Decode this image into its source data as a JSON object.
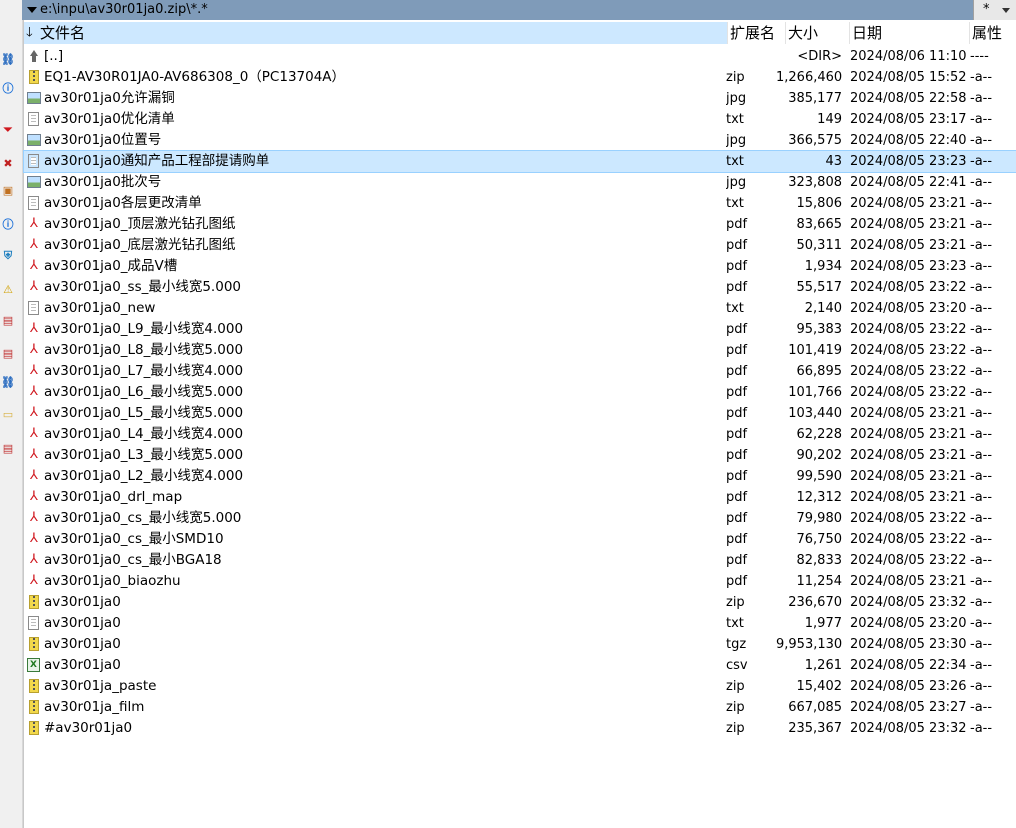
{
  "pathbar": {
    "path": "e:\\inpu\\av30r01ja0.zip\\*.*",
    "filter": "*"
  },
  "left_icons": [
    "network-icon",
    "info-icon",
    "pdf-icon",
    "delete-icon",
    "image-icon",
    "info-icon",
    "shield-icon",
    "warning-icon",
    "document-icon",
    "document-icon",
    "network-icon",
    "folder-icon",
    "document-icon"
  ],
  "columns": {
    "name": "文件名",
    "ext": "扩展名",
    "size": "大小",
    "date": "日期",
    "attr": "属性"
  },
  "files": [
    {
      "name": "[..]",
      "ext": "",
      "size": "<DIR>",
      "date": "2024/08/06 11:10",
      "attr": "----",
      "icon": "up"
    },
    {
      "name": "EQ1-AV30R01JA0-AV686308_0（PC13704A）",
      "ext": "zip",
      "size": "1,266,460",
      "date": "2024/08/05 15:52",
      "attr": "-a--",
      "icon": "zip"
    },
    {
      "name": "av30r01ja0允许漏铜",
      "ext": "jpg",
      "size": "385,177",
      "date": "2024/08/05 22:58",
      "attr": "-a--",
      "icon": "img"
    },
    {
      "name": "av30r01ja0优化清单",
      "ext": "txt",
      "size": "149",
      "date": "2024/08/05 23:17",
      "attr": "-a--",
      "icon": "txt"
    },
    {
      "name": "av30r01ja0位置号",
      "ext": "jpg",
      "size": "366,575",
      "date": "2024/08/05 22:40",
      "attr": "-a--",
      "icon": "img"
    },
    {
      "name": "av30r01ja0通知产品工程部提请购单",
      "ext": "txt",
      "size": "43",
      "date": "2024/08/05 23:23",
      "attr": "-a--",
      "icon": "txt",
      "selected": true
    },
    {
      "name": "av30r01ja0批次号",
      "ext": "jpg",
      "size": "323,808",
      "date": "2024/08/05 22:41",
      "attr": "-a--",
      "icon": "img"
    },
    {
      "name": "av30r01ja0各层更改清单",
      "ext": "txt",
      "size": "15,806",
      "date": "2024/08/05 23:21",
      "attr": "-a--",
      "icon": "txt"
    },
    {
      "name": "av30r01ja0_顶层激光钻孔图纸",
      "ext": "pdf",
      "size": "83,665",
      "date": "2024/08/05 23:21",
      "attr": "-a--",
      "icon": "pdf"
    },
    {
      "name": "av30r01ja0_底层激光钻孔图纸",
      "ext": "pdf",
      "size": "50,311",
      "date": "2024/08/05 23:21",
      "attr": "-a--",
      "icon": "pdf"
    },
    {
      "name": "av30r01ja0_成品V槽",
      "ext": "pdf",
      "size": "1,934",
      "date": "2024/08/05 23:23",
      "attr": "-a--",
      "icon": "pdf"
    },
    {
      "name": "av30r01ja0_ss_最小线宽5.000",
      "ext": "pdf",
      "size": "55,517",
      "date": "2024/08/05 23:22",
      "attr": "-a--",
      "icon": "pdf"
    },
    {
      "name": "av30r01ja0_new",
      "ext": "txt",
      "size": "2,140",
      "date": "2024/08/05 23:20",
      "attr": "-a--",
      "icon": "txt"
    },
    {
      "name": "av30r01ja0_L9_最小线宽4.000",
      "ext": "pdf",
      "size": "95,383",
      "date": "2024/08/05 23:22",
      "attr": "-a--",
      "icon": "pdf"
    },
    {
      "name": "av30r01ja0_L8_最小线宽5.000",
      "ext": "pdf",
      "size": "101,419",
      "date": "2024/08/05 23:22",
      "attr": "-a--",
      "icon": "pdf"
    },
    {
      "name": "av30r01ja0_L7_最小线宽4.000",
      "ext": "pdf",
      "size": "66,895",
      "date": "2024/08/05 23:22",
      "attr": "-a--",
      "icon": "pdf"
    },
    {
      "name": "av30r01ja0_L6_最小线宽5.000",
      "ext": "pdf",
      "size": "101,766",
      "date": "2024/08/05 23:22",
      "attr": "-a--",
      "icon": "pdf"
    },
    {
      "name": "av30r01ja0_L5_最小线宽5.000",
      "ext": "pdf",
      "size": "103,440",
      "date": "2024/08/05 23:21",
      "attr": "-a--",
      "icon": "pdf"
    },
    {
      "name": "av30r01ja0_L4_最小线宽4.000",
      "ext": "pdf",
      "size": "62,228",
      "date": "2024/08/05 23:21",
      "attr": "-a--",
      "icon": "pdf"
    },
    {
      "name": "av30r01ja0_L3_最小线宽5.000",
      "ext": "pdf",
      "size": "90,202",
      "date": "2024/08/05 23:21",
      "attr": "-a--",
      "icon": "pdf"
    },
    {
      "name": "av30r01ja0_L2_最小线宽4.000",
      "ext": "pdf",
      "size": "99,590",
      "date": "2024/08/05 23:21",
      "attr": "-a--",
      "icon": "pdf"
    },
    {
      "name": "av30r01ja0_drl_map",
      "ext": "pdf",
      "size": "12,312",
      "date": "2024/08/05 23:21",
      "attr": "-a--",
      "icon": "pdf"
    },
    {
      "name": "av30r01ja0_cs_最小线宽5.000",
      "ext": "pdf",
      "size": "79,980",
      "date": "2024/08/05 23:22",
      "attr": "-a--",
      "icon": "pdf"
    },
    {
      "name": "av30r01ja0_cs_最小SMD10",
      "ext": "pdf",
      "size": "76,750",
      "date": "2024/08/05 23:22",
      "attr": "-a--",
      "icon": "pdf"
    },
    {
      "name": "av30r01ja0_cs_最小BGA18",
      "ext": "pdf",
      "size": "82,833",
      "date": "2024/08/05 23:22",
      "attr": "-a--",
      "icon": "pdf"
    },
    {
      "name": "av30r01ja0_biaozhu",
      "ext": "pdf",
      "size": "11,254",
      "date": "2024/08/05 23:21",
      "attr": "-a--",
      "icon": "pdf"
    },
    {
      "name": "av30r01ja0",
      "ext": "zip",
      "size": "236,670",
      "date": "2024/08/05 23:32",
      "attr": "-a--",
      "icon": "zip"
    },
    {
      "name": "av30r01ja0",
      "ext": "txt",
      "size": "1,977",
      "date": "2024/08/05 23:20",
      "attr": "-a--",
      "icon": "txt"
    },
    {
      "name": "av30r01ja0",
      "ext": "tgz",
      "size": "9,953,130",
      "date": "2024/08/05 23:30",
      "attr": "-a--",
      "icon": "zip"
    },
    {
      "name": "av30r01ja0",
      "ext": "csv",
      "size": "1,261",
      "date": "2024/08/05 22:34",
      "attr": "-a--",
      "icon": "csv"
    },
    {
      "name": "av30r01ja_paste",
      "ext": "zip",
      "size": "15,402",
      "date": "2024/08/05 23:26",
      "attr": "-a--",
      "icon": "zip"
    },
    {
      "name": "av30r01ja_film",
      "ext": "zip",
      "size": "667,085",
      "date": "2024/08/05 23:27",
      "attr": "-a--",
      "icon": "zip"
    },
    {
      "name": "#av30r01ja0",
      "ext": "zip",
      "size": "235,367",
      "date": "2024/08/05 23:32",
      "attr": "-a--",
      "icon": "zip"
    }
  ],
  "colors": {
    "path_bar": "#7f9bb9",
    "header_sort": "#cde8ff",
    "selection": "#cce8ff",
    "pdf": "#d0181f"
  }
}
